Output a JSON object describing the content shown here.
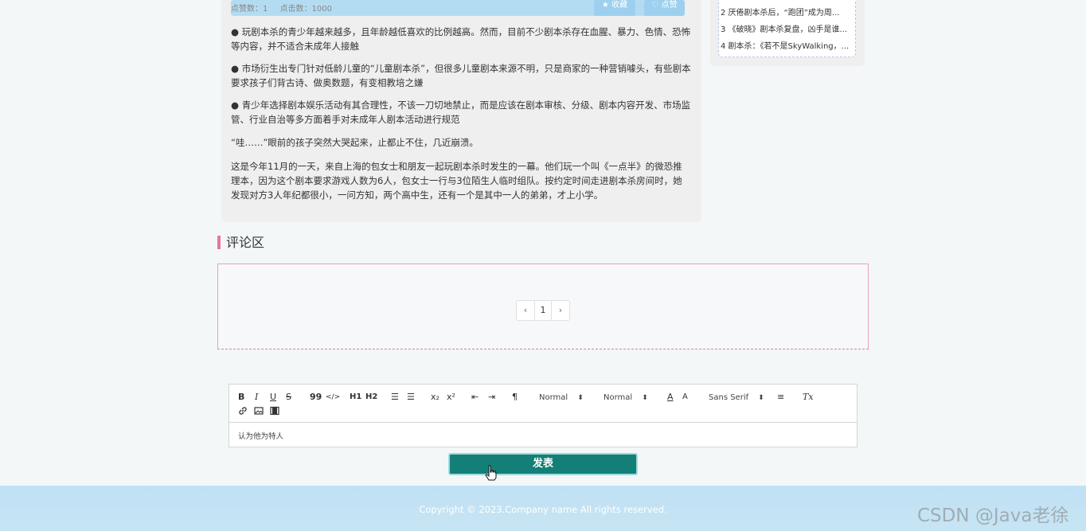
{
  "article": {
    "stats": {
      "likes": "点赞数：1",
      "clicks": "点击数：1000"
    },
    "favorite_label": "收藏",
    "like_label": "点赞",
    "paragraphs": [
      "● 玩剧本杀的青少年越来越多，且年龄越低喜欢的比例越高。然而，目前不少剧本杀存在血腥、暴力、色情、恐怖等内容，并不适合未成年人接触",
      "● 市场衍生出专门针对低龄儿童的“儿童剧本杀”，但很多儿童剧本来源不明，只是商家的一种营销噱头，有些剧本要求孩子们背古诗、做奥数题，有变相教培之嫌",
      "● 青少年选择剧本娱乐活动有其合理性，不该一刀切地禁止，而是应该在剧本审核、分级、剧本内容开发、市场监管、行业自治等多方面着手对未成年人剧本活动进行规范",
      "“哇……”眼前的孩子突然大哭起来，止都止不住，几近崩溃。",
      "这是今年11月的一天，来自上海的包女士和朋友一起玩剧本杀时发生的一幕。他们玩一个叫《一点半》的微恐推理本，因为这个剧本要求游戏人数为6人，包女士一行与3位陌生人临时组队。按约定时间走进剧本杀房间时，她发现对方3人年纪都很小，一问方知，两个高中生，还有一个是其中一人的弟弟，才上小学。"
    ]
  },
  "sidebar": {
    "items": [
      "2 厌倦剧本杀后，“跑团”成为周...",
      "3 《破晓》剧本杀复盘，凶手是谁...",
      "4 剧本杀：《若不是SkyWalking，..."
    ]
  },
  "comments": {
    "title": "评论区",
    "pager": {
      "prev": "‹",
      "page": "1",
      "next": "›"
    }
  },
  "editor": {
    "toolbar": {
      "bold": "B",
      "italic": "I",
      "underline": "U",
      "strike": "S",
      "quote": "99",
      "code": "</>",
      "h1": "H1",
      "h2": "H2",
      "ordered_list": "☰",
      "bullet_list": "☰",
      "subscript": "x₂",
      "superscript": "x²",
      "outdent": "⇤",
      "indent": "⇥",
      "direction": "¶",
      "size_select": "Normal",
      "header_select": "Normal",
      "color": "A",
      "background": "A",
      "font_select": "Sans Serif",
      "align": "≡",
      "clean": "Tx"
    },
    "content": "认为他为特人"
  },
  "submit_label": "发表",
  "footer": {
    "copyright": "Copyright © 2023.Company name All rights reserved."
  },
  "watermark": "CSDN @Java老徐"
}
